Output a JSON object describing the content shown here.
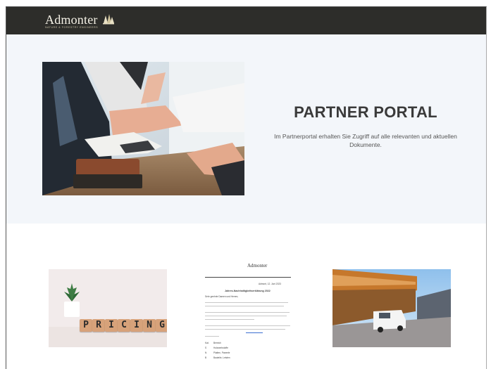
{
  "header": {
    "logo_text": "Admonter",
    "logo_sub": "NATURE & FORESTRY ENGINEERS",
    "logo_icon": "tree-logo-icon",
    "bg_color": "#2d2d2a"
  },
  "hero": {
    "title": "PARTNER PORTAL",
    "text": "Im Partnerportal erhalten Sie Zugriff auf alle relevanten und aktuellen Dokumente.",
    "bg_color": "#f3f6fa"
  },
  "cards": {
    "pricing": {
      "letters": [
        "P",
        "R",
        "I",
        "C",
        "I",
        "N",
        "G"
      ]
    },
    "document": {
      "logo_text": "Admonter",
      "date": "Admont, 12. Juni 2023",
      "heading": "Jahres-Nachhaltigkeitserklärung 2022",
      "greeting": "Sehr geehrte Damen und Herren,",
      "rows": [
        {
          "key": "Kat.",
          "val": "Bereich"
        },
        {
          "key": "S",
          "val": "Holzwerkstoffe"
        },
        {
          "key": "N",
          "val": "Platten, Paneele"
        },
        {
          "key": "B",
          "val": "Bauteile, Leisten"
        }
      ]
    },
    "building": {}
  }
}
